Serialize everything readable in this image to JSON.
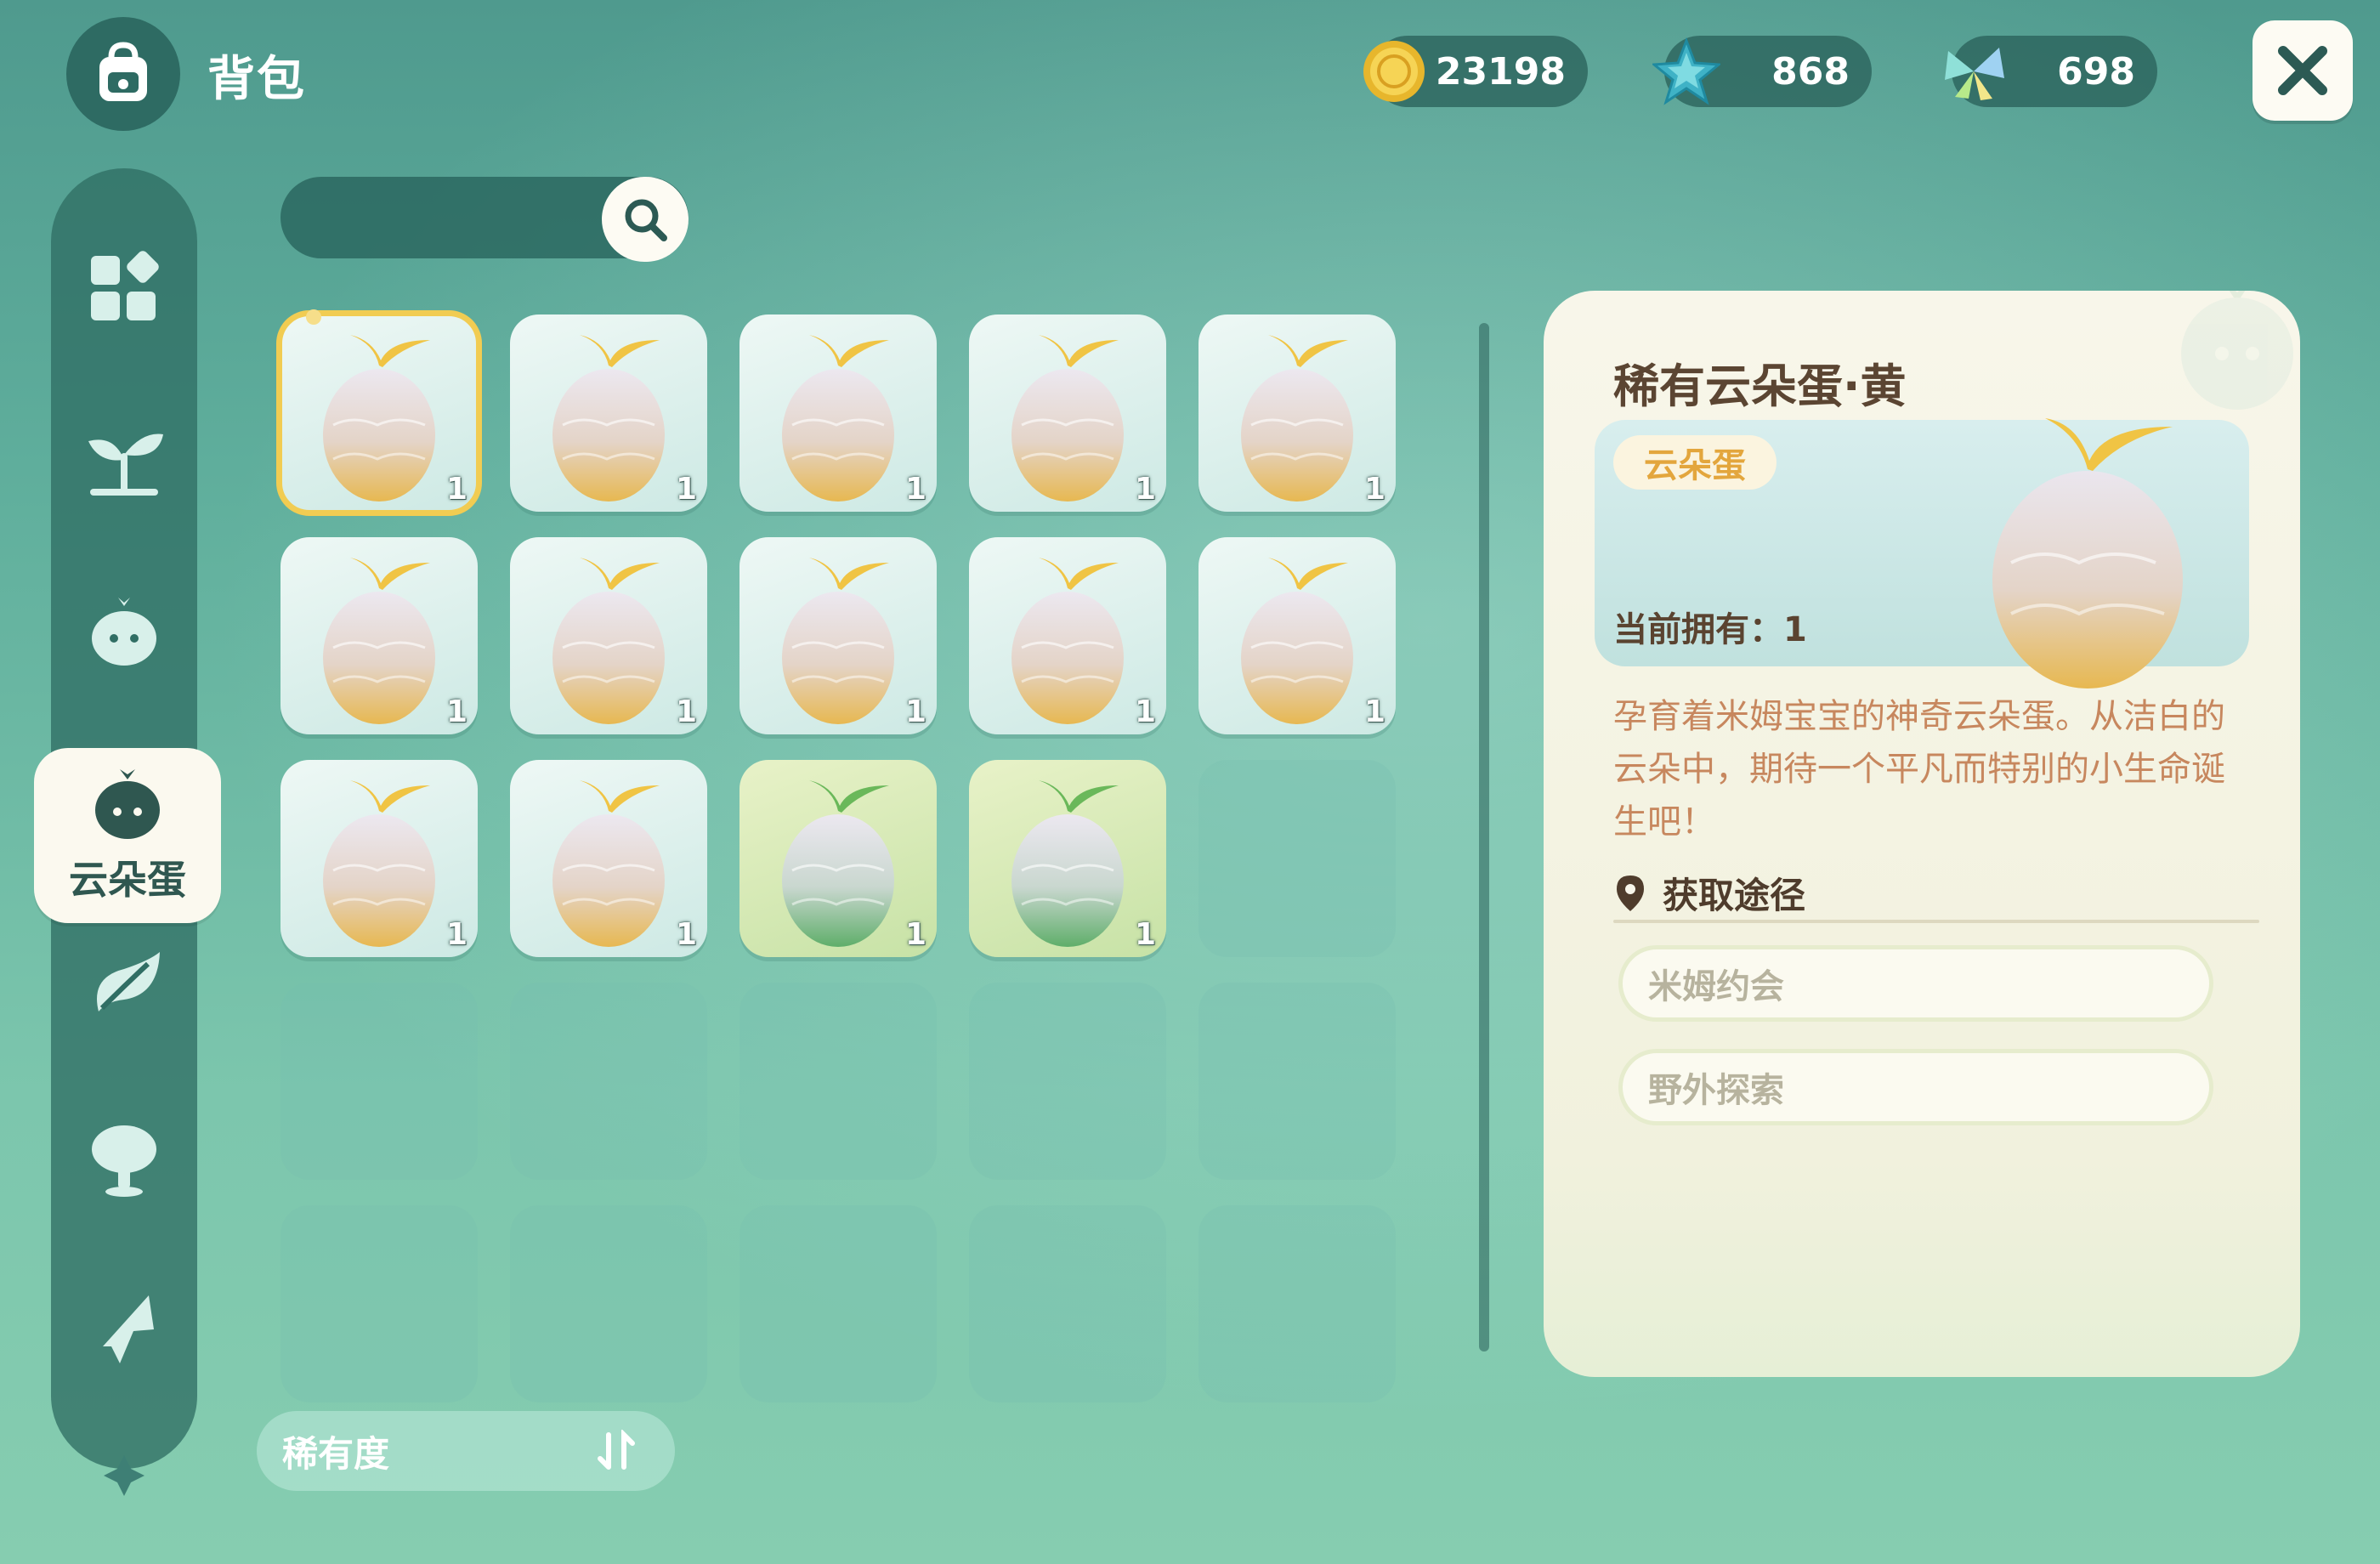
{
  "header": {
    "title": "背包",
    "icon": "backpack-icon"
  },
  "currencies": [
    {
      "name": "coin",
      "icon": "gold-coin-icon",
      "value": "23198"
    },
    {
      "name": "star",
      "icon": "blue-star-icon",
      "value": "868"
    },
    {
      "name": "crystal",
      "icon": "crystal-butterfly-icon",
      "value": "698"
    }
  ],
  "close": {
    "icon": "close-icon"
  },
  "sidebar": {
    "items": [
      {
        "icon": "all-items-icon"
      },
      {
        "icon": "sprout-icon"
      },
      {
        "icon": "slime-icon"
      },
      {
        "icon": "cloud-egg-icon",
        "label": "云朵蛋",
        "active": true
      },
      {
        "icon": "leaf-icon"
      },
      {
        "icon": "tree-icon"
      },
      {
        "icon": "pin-leaf-icon"
      }
    ]
  },
  "search": {
    "icon": "search-icon"
  },
  "inventory": {
    "slots": [
      {
        "kind": "yellow",
        "count": "1",
        "selected": true
      },
      {
        "kind": "yellow",
        "count": "1"
      },
      {
        "kind": "yellow",
        "count": "1"
      },
      {
        "kind": "yellow",
        "count": "1"
      },
      {
        "kind": "yellow",
        "count": "1"
      },
      {
        "kind": "yellow",
        "count": "1"
      },
      {
        "kind": "yellow",
        "count": "1"
      },
      {
        "kind": "yellow",
        "count": "1"
      },
      {
        "kind": "yellow",
        "count": "1"
      },
      {
        "kind": "yellow",
        "count": "1"
      },
      {
        "kind": "yellow",
        "count": "1"
      },
      {
        "kind": "yellow",
        "count": "1"
      },
      {
        "kind": "green",
        "count": "1"
      },
      {
        "kind": "green",
        "count": "1"
      }
    ]
  },
  "detail": {
    "title": "稀有云朵蛋·黄",
    "type_tag": "云朵蛋",
    "owned_label": "当前拥有：1",
    "description": "孕育着米姆宝宝的神奇云朵蛋。从洁白的云朵中，期待一个平凡而特别的小生命诞生吧！",
    "sources_header": "获取途径",
    "sources": [
      "米姆约会",
      "野外探索"
    ]
  },
  "sort": {
    "label": "稀有度",
    "icon": "sort-icon"
  },
  "colors": {
    "accent_yellow": "#f1cc52",
    "panel_bg": "#f8f6ea",
    "tag_text": "#e3a63d",
    "desc_text": "#c7875e",
    "sidebar_bg": "#306e64"
  }
}
